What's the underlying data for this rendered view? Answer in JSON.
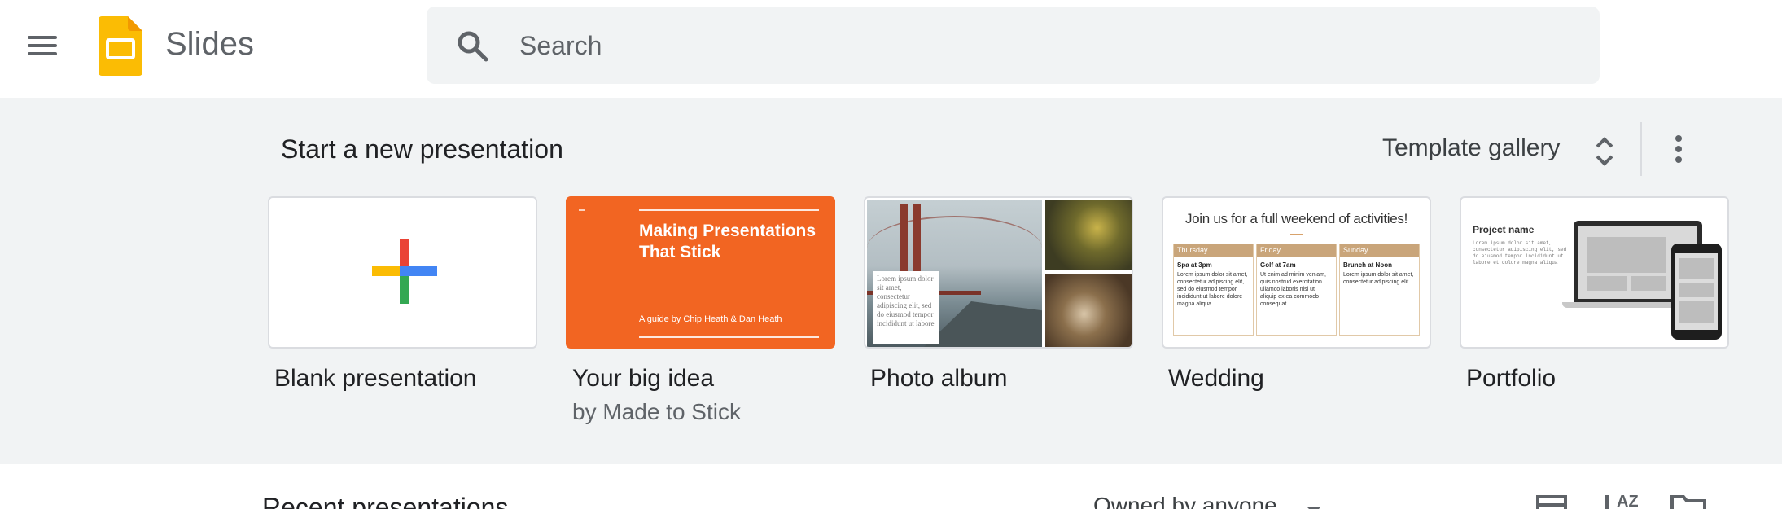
{
  "header": {
    "app_name": "Slides",
    "search_placeholder": "Search",
    "icons": [
      "main-menu-icon",
      "slides-logo-icon",
      "search-icon"
    ],
    "logo_color": "#FBBC04"
  },
  "templates": {
    "section_title": "Start a new presentation",
    "gallery_label": "Template gallery",
    "items": [
      {
        "name": "Blank presentation",
        "subtitle": ""
      },
      {
        "name": "Your big idea",
        "subtitle": "by Made to Stick",
        "thumb_title": "Making Presentations That Stick",
        "thumb_sub": "A guide by Chip Heath & Dan Heath",
        "accent": "#F26522"
      },
      {
        "name": "Photo album",
        "subtitle": "",
        "thumb_caption": "Lorem ipsum dolor sit amet, consectetur adipiscing elit, sed do eiusmod tempor incididunt ut labore"
      },
      {
        "name": "Wedding",
        "subtitle": "",
        "thumb_title": "Join us for a full weekend of activities!",
        "days": [
          {
            "day": "Thursday",
            "when": "Spa at 3pm",
            "text": "Lorem ipsum dolor sit amet, consectetur adipiscing elit, sed do eiusmod tempor incididunt ut labore dolore magna aliqua."
          },
          {
            "day": "Friday",
            "when": "Golf at 7am",
            "text": "Ut enim ad minim veniam, quis nostrud exercitation ullamco laboris nisi ut aliquip ex ea commodo consequat."
          },
          {
            "day": "Sunday",
            "when": "Brunch at Noon",
            "text": "Lorem ipsum dolor sit amet, consectetur adipiscing elit"
          }
        ]
      },
      {
        "name": "Portfolio",
        "subtitle": "",
        "thumb_title": "Project name",
        "thumb_text": "Lorem ipsum dolor sit amet, consectetur adipiscing elit, sed do eiusmod tempor incididunt ut labore et dolore magna aliqua"
      }
    ]
  },
  "recent": {
    "title": "Recent presentations",
    "owner_filter": "Owned by anyone"
  },
  "colors": {
    "surface": "#F1F3F4",
    "google_red": "#EA4335",
    "google_blue": "#4285F4",
    "google_yellow": "#FBBC04",
    "google_green": "#34A853"
  }
}
